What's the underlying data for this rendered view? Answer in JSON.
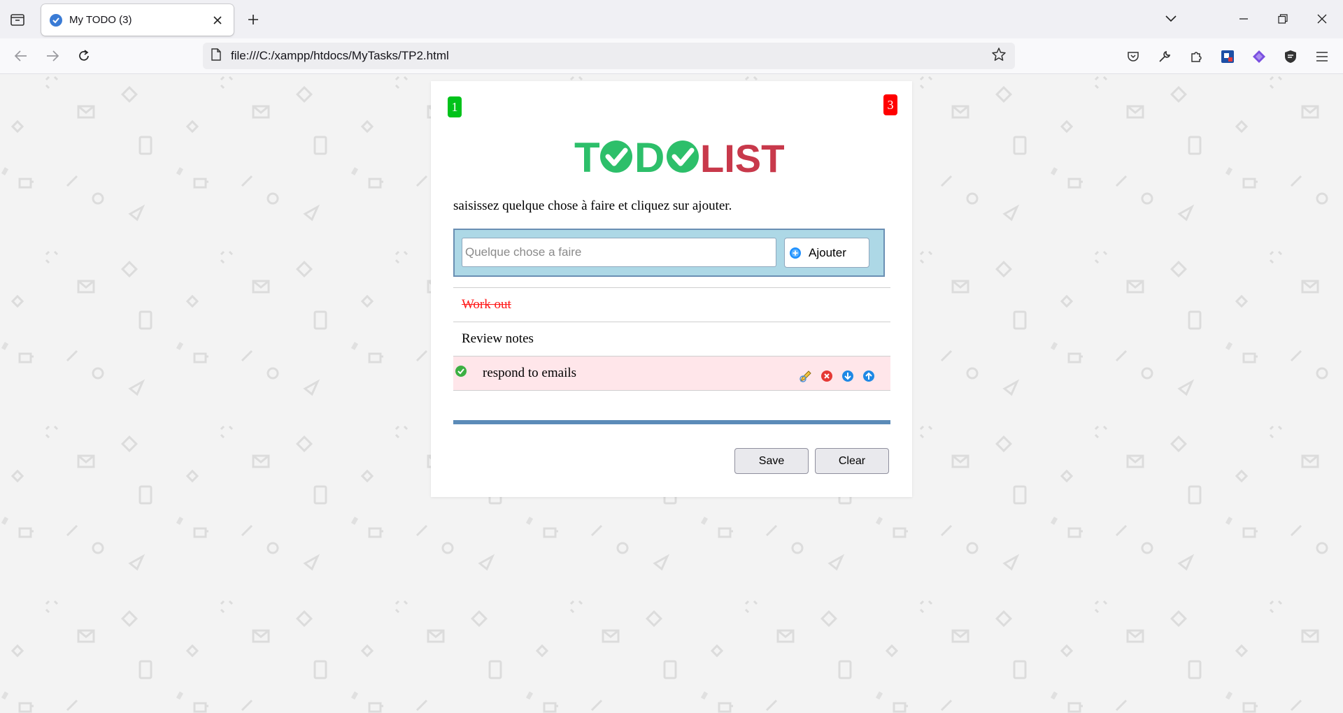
{
  "browser": {
    "tab": {
      "title": "My TODO (3)"
    },
    "url": "file:///C:/xampp/htdocs/MyTasks/TP2.html"
  },
  "app": {
    "done_count": "1",
    "total_count": "3",
    "logo": {
      "part1": "T",
      "part2": "D",
      "part3": "LIST"
    },
    "instructions": "saisissez quelque chose à faire et cliquez sur ajouter.",
    "input": {
      "value": "",
      "placeholder": "Quelque chose a faire"
    },
    "add_button": "Ajouter",
    "tasks": [
      {
        "text": "Work out",
        "done": true
      },
      {
        "text": "Review notes",
        "done": false
      },
      {
        "text": "respond to emails",
        "done": false,
        "selected": true
      }
    ],
    "save_button": "Save",
    "clear_button": "Clear"
  },
  "colors": {
    "logo_green": "#2dbf6a",
    "logo_red": "#c8394b",
    "badge_done": "#00c21a",
    "badge_total": "#ff0000",
    "entry_box": "#add8e6",
    "separator": "#5b8bb8",
    "done_text": "#ff1a1a",
    "selected_row": "#ffe6ea"
  }
}
